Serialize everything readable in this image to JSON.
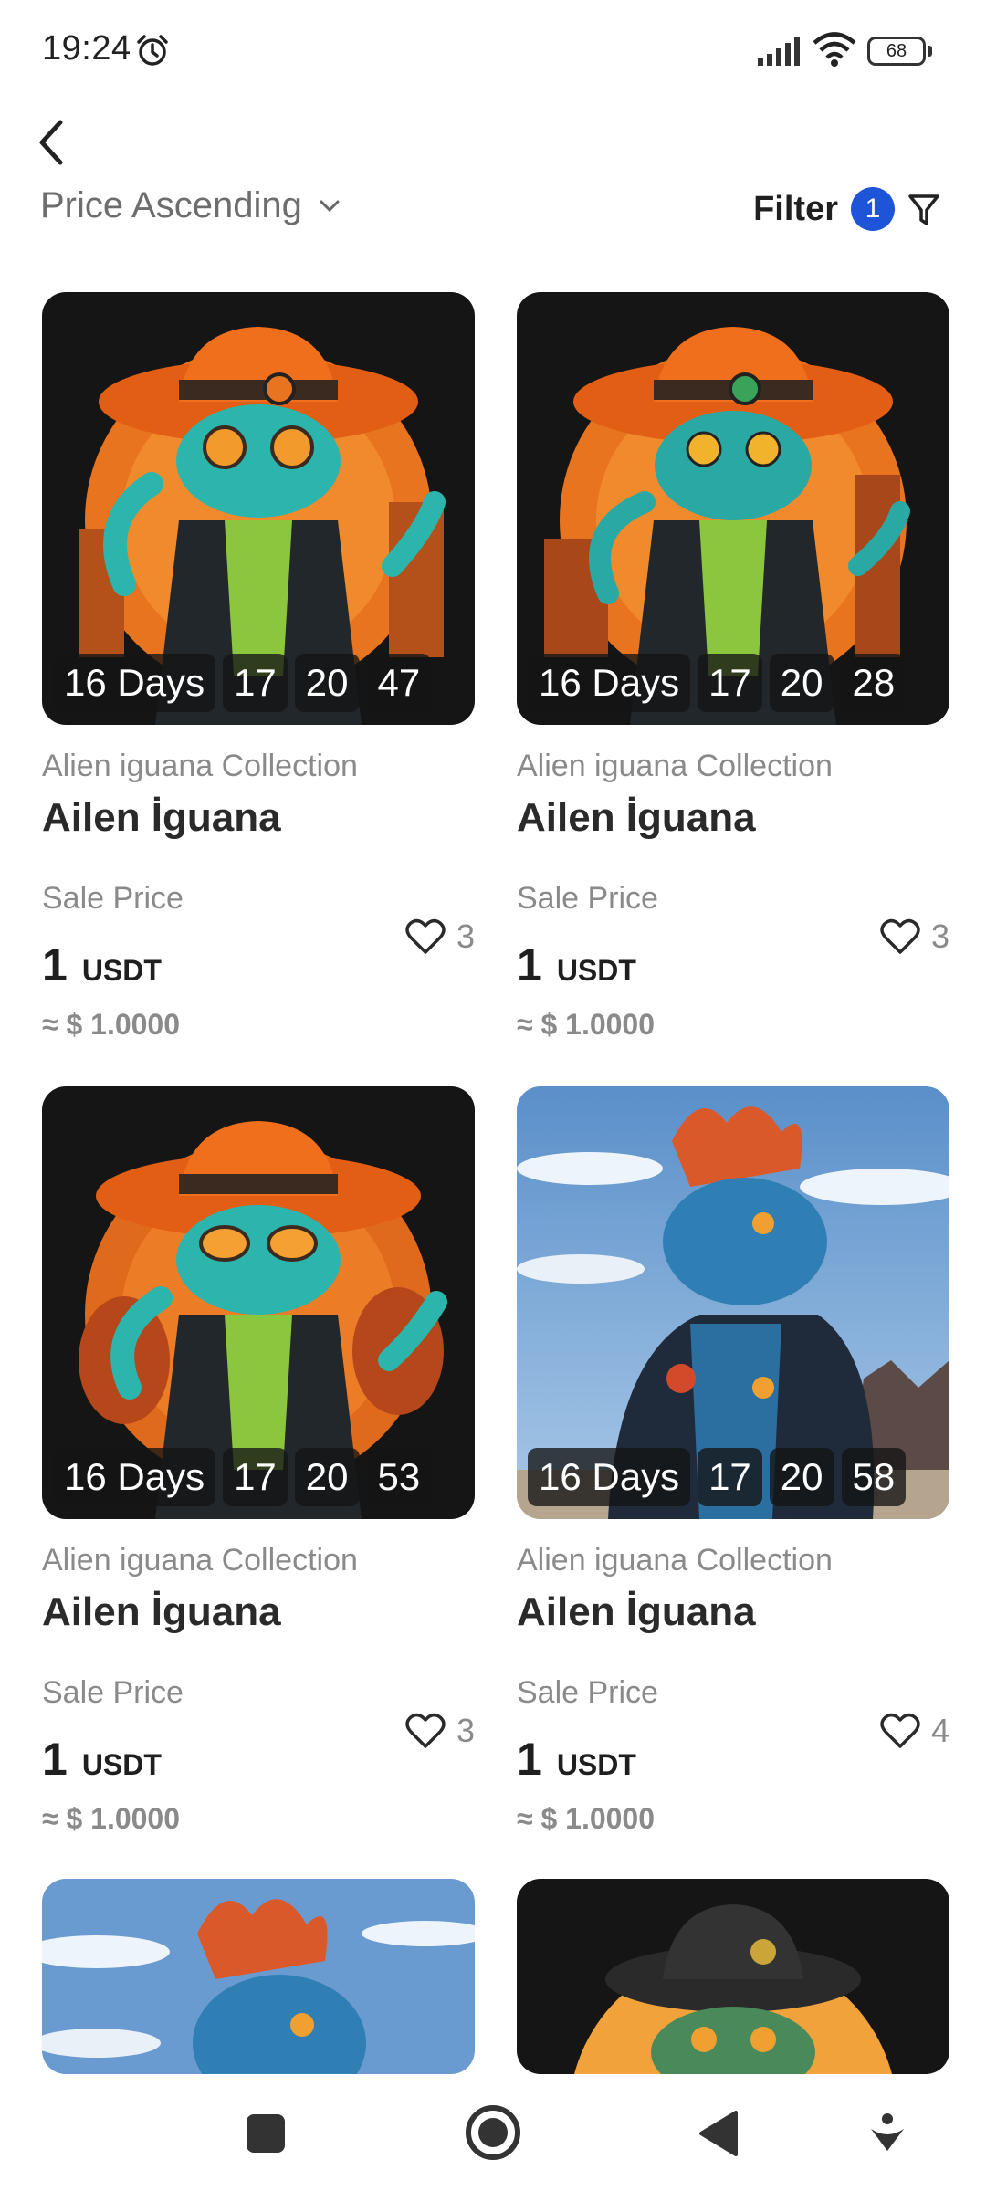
{
  "status_bar": {
    "time": "19:24",
    "battery": "68",
    "icons": [
      "alarm-icon",
      "signal-icon",
      "wifi-icon",
      "battery-icon"
    ]
  },
  "header": {
    "back_icon": "chevron-left-icon",
    "sort_label": "Price Ascending",
    "filter_label": "Filter",
    "filter_count": "1"
  },
  "cards": [
    {
      "collection": "Alien iguana Collection",
      "name": "Ailen İguana",
      "sale_label": "Sale Price",
      "price": "1",
      "currency": "USDT",
      "approx": "≈ $ 1.0000",
      "likes": "3",
      "countdown": {
        "days": "16 Days",
        "hours": "17",
        "minutes": "20",
        "seconds": "47"
      }
    },
    {
      "collection": "Alien iguana Collection",
      "name": "Ailen İguana",
      "sale_label": "Sale Price",
      "price": "1",
      "currency": "USDT",
      "approx": "≈ $ 1.0000",
      "likes": "3",
      "countdown": {
        "days": "16 Days",
        "hours": "17",
        "minutes": "20",
        "seconds": "28"
      }
    },
    {
      "collection": "Alien iguana Collection",
      "name": "Ailen İguana",
      "sale_label": "Sale Price",
      "price": "1",
      "currency": "USDT",
      "approx": "≈ $ 1.0000",
      "likes": "3",
      "countdown": {
        "days": "16 Days",
        "hours": "17",
        "minutes": "20",
        "seconds": "53"
      }
    },
    {
      "collection": "Alien iguana Collection",
      "name": "Ailen İguana",
      "sale_label": "Sale Price",
      "price": "1",
      "currency": "USDT",
      "approx": "≈ $ 1.0000",
      "likes": "4",
      "countdown": {
        "days": "16 Days",
        "hours": "17",
        "minutes": "20",
        "seconds": "58"
      }
    }
  ],
  "nav": [
    "recents-button",
    "home-button",
    "back-button",
    "assistant-button"
  ]
}
